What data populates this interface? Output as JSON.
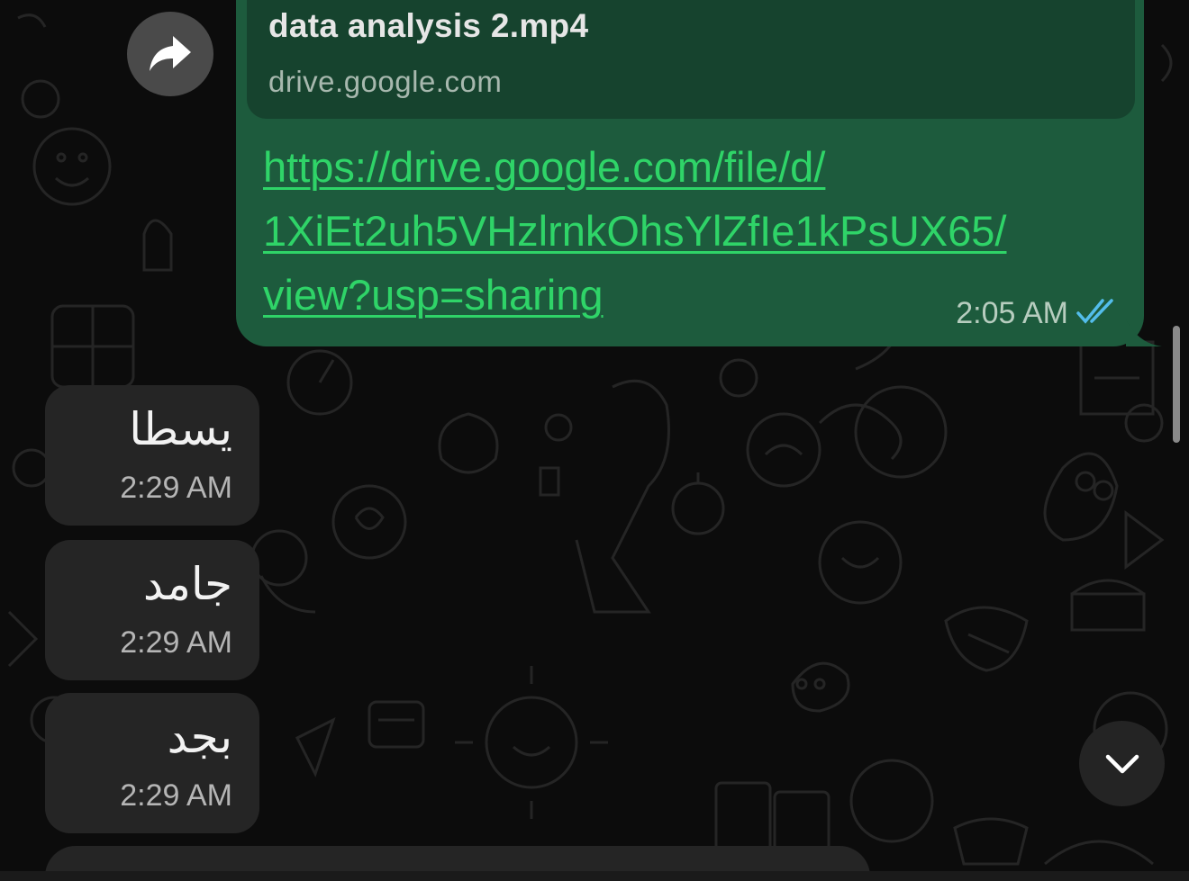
{
  "shared_file": {
    "title": "data analysis 2.mp4",
    "domain": "drive.google.com",
    "link_lines": [
      "https://drive.google.com/file/d/",
      "1XiEt2uh5VHzlrnkOhsYlZfIe1kPsUX65/",
      "view?usp=sharing"
    ],
    "time": "2:05 AM",
    "status_icon": "double-check-read-icon"
  },
  "incoming_messages": [
    {
      "text": "يسطا",
      "time": "2:29 AM"
    },
    {
      "text": "جامد",
      "time": "2:29 AM"
    },
    {
      "text": "بجد",
      "time": "2:29 AM"
    }
  ],
  "controls": {
    "forward_icon": "forward-arrow-icon",
    "scroll_down_icon": "chevron-down-icon"
  },
  "colors": {
    "outgoing_bubble": "#1d5b3d",
    "link_preview": "#16432e",
    "link": "#2fd468",
    "incoming_bubble": "#252525",
    "read_ticks": "#53bdeb",
    "background": "#0c0c0c"
  }
}
